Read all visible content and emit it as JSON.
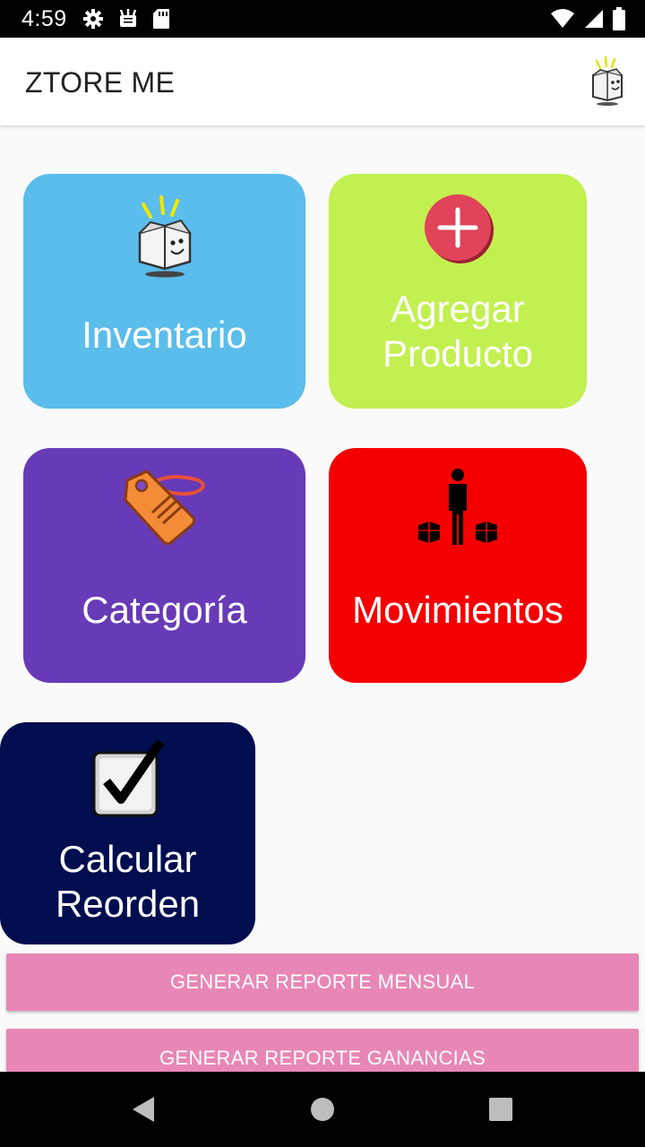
{
  "status_bar": {
    "time": "4:59",
    "left_icons": [
      "gear-icon",
      "android-debug-icon",
      "sd-card-icon"
    ],
    "right_icons": [
      "wifi-icon",
      "signal-icon",
      "battery-icon"
    ]
  },
  "app_bar": {
    "title": "ZTORE ME",
    "logo_icon": "happy-box-logo-icon"
  },
  "tiles": [
    {
      "label": "Inventario",
      "color": "#5bbdeb",
      "icon": "happy-box-icon"
    },
    {
      "label_line1": "Agregar",
      "label_line2": "Producto",
      "color": "#c2f050",
      "icon": "add-circle-icon"
    },
    {
      "label": "Categoría",
      "color": "#673ab7",
      "icon": "price-tag-icon"
    },
    {
      "label": "Movimientos",
      "color": "#f50000",
      "icon": "person-boxes-icon"
    },
    {
      "label_line1": "Calcular",
      "label_line2": "Reorden",
      "color": "#000d4f",
      "icon": "checkbox-icon"
    }
  ],
  "buttons": {
    "monthly_report": "GENERAR REPORTE MENSUAL",
    "profit_report": "GENERAR REPORTE GANANCIAS",
    "color": "#e887b5"
  },
  "nav_bar": {
    "icons": [
      "back-icon",
      "home-icon",
      "recents-icon"
    ]
  }
}
